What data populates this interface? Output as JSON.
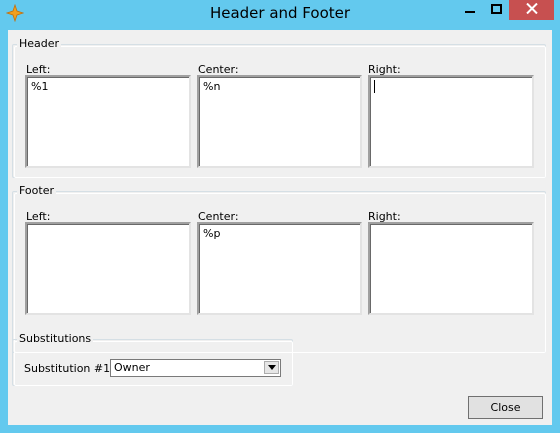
{
  "window": {
    "title": "Header and Footer",
    "icon": "app-icon",
    "controls": [
      "minimize-icon",
      "maximize-icon",
      "close-icon"
    ]
  },
  "header": {
    "group_label": "Header",
    "left": {
      "label": "Left:",
      "value": "%1"
    },
    "center": {
      "label": "Center:",
      "value": "%n"
    },
    "right": {
      "label": "Right:",
      "value": ""
    }
  },
  "footer": {
    "group_label": "Footer",
    "left": {
      "label": "Left:",
      "value": ""
    },
    "center": {
      "label": "Center:",
      "value": "%p"
    },
    "right": {
      "label": "Right:",
      "value": ""
    }
  },
  "substitutions": {
    "group_label": "Substitutions",
    "field_label": "Substitution #1:",
    "selected": "Owner"
  },
  "buttons": {
    "close_label": "Close"
  },
  "colors": {
    "titlebar": "#63c9ee",
    "close_button": "#c75050",
    "dialog_background": "#f0f0f0"
  }
}
